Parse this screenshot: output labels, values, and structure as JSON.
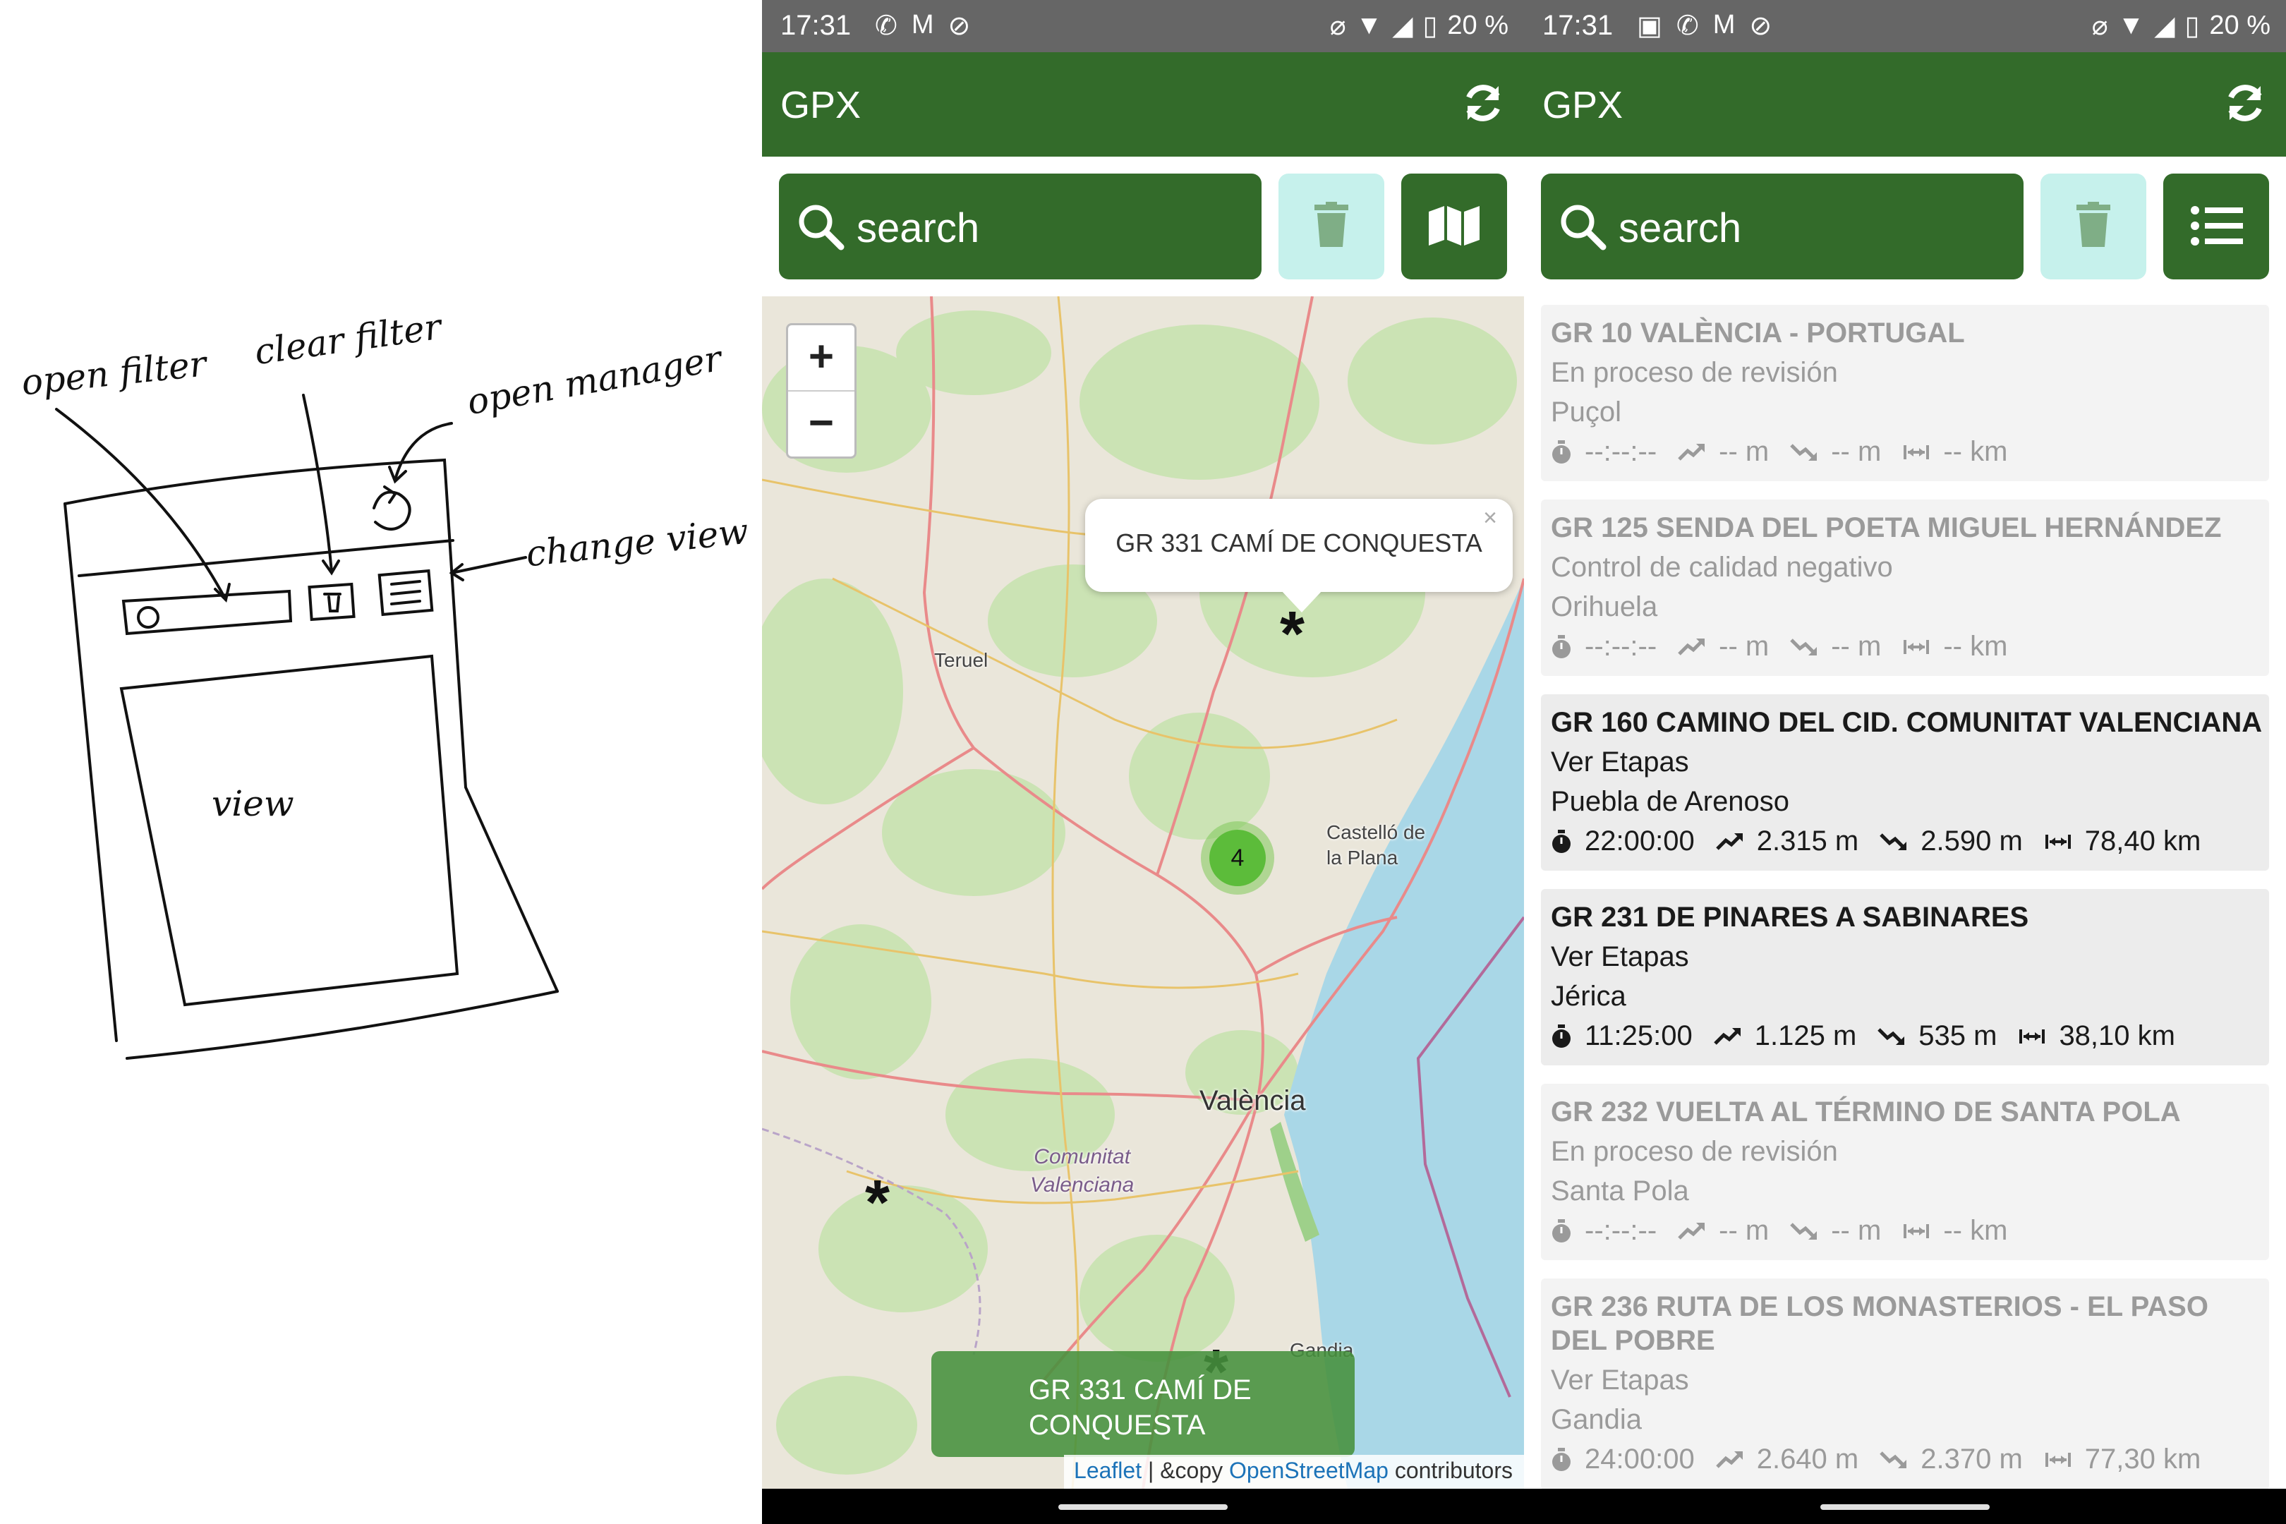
{
  "sketch": {
    "labels": {
      "open_filter": "open filter",
      "clear_filter": "clear filter",
      "open_manager": "open manager",
      "change_view": "change view",
      "view": "view"
    }
  },
  "status_bar": {
    "time": "17:31",
    "battery": "20 %",
    "left_icons": [
      "whatsapp-icon",
      "gmail-icon",
      "sync-icon"
    ],
    "right_icons": [
      "mute-icon",
      "wifi-icon",
      "signal-icon",
      "battery-icon"
    ]
  },
  "app_bar": {
    "title": "GPX"
  },
  "toolbar": {
    "search_label": "search",
    "map_view_icon": "map-icon",
    "list_view_icon": "list-icon"
  },
  "map": {
    "zoom_in": "+",
    "zoom_out": "−",
    "popup_text": "GR 331 CAMÍ DE CONQUESTA",
    "popup_close": "×",
    "cluster_count": "4",
    "marker_symbol": "*",
    "place_labels": {
      "teruel": "Teruel",
      "castello": "Castelló de\nla Plana",
      "valencia": "València",
      "region": "Comunitat\nValenciana",
      "gandia": "Gandia"
    },
    "toast_text": "GR 331 CAMÍ DE CONQUESTA",
    "attribution_link1": "Leaflet",
    "attribution_mid": " | &copy ",
    "attribution_link2": "OpenStreetMap",
    "attribution_tail": " contributors",
    "colors": {
      "sea": "#a9d7e7",
      "land": "#eae6da",
      "forest": "#cbe3b4",
      "road": "#e98a8a"
    }
  },
  "routes": [
    {
      "title": "GR 10 VALÈNCIA - PORTUGAL",
      "status": "En proceso de revisión",
      "place": "Puçol",
      "time": "--:--:--",
      "ascent": "-- m",
      "descent": "-- m",
      "distance": "-- km",
      "enabled": false
    },
    {
      "title": "GR 125 SENDA DEL POETA MIGUEL HERNÁNDEZ",
      "status": "Control de calidad negativo",
      "place": "Orihuela",
      "time": "--:--:--",
      "ascent": "-- m",
      "descent": "-- m",
      "distance": "-- km",
      "enabled": false
    },
    {
      "title": "GR 160 CAMINO DEL CID. COMUNITAT VALENCIANA",
      "status": "Ver Etapas",
      "place": "Puebla de Arenoso",
      "time": "22:00:00",
      "ascent": "2.315 m",
      "descent": "2.590 m",
      "distance": "78,40 km",
      "enabled": true
    },
    {
      "title": "GR 231 DE PINARES A SABINARES",
      "status": "Ver Etapas",
      "place": "Jérica",
      "time": "11:25:00",
      "ascent": "1.125 m",
      "descent": "535 m",
      "distance": "38,10 km",
      "enabled": true
    },
    {
      "title": "GR 232 VUELTA AL TÉRMINO DE SANTA POLA",
      "status": "En proceso de revisión",
      "place": "Santa Pola",
      "time": "--:--:--",
      "ascent": "-- m",
      "descent": "-- m",
      "distance": "-- km",
      "enabled": false
    },
    {
      "title": "GR 236 RUTA DE LOS MONASTERIOS - EL PASO DEL POBRE",
      "status": "Ver Etapas",
      "place": "Gandia",
      "time": "24:00:00",
      "ascent": "2.640 m",
      "descent": "2.370 m",
      "distance": "77,30 km",
      "enabled": false
    }
  ]
}
